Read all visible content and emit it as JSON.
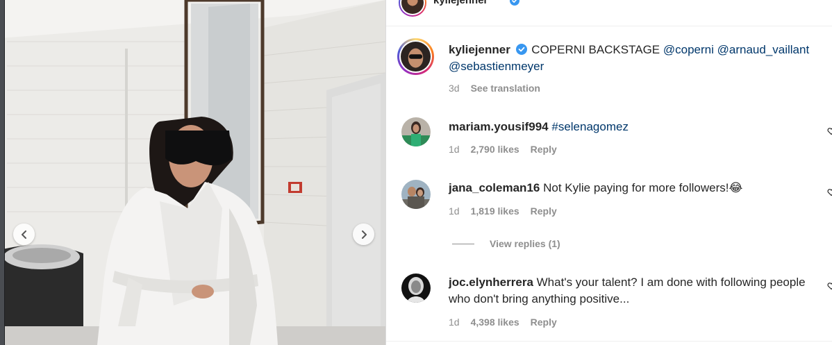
{
  "header": {
    "username": "kyliejenner"
  },
  "post": {
    "author": "kyliejenner",
    "caption_text": "COPERNI BACKSTAGE",
    "mentions": [
      "@coperni",
      "@arnaud_vaillant",
      "@sebastienmeyer"
    ],
    "time": "3d",
    "see_translation": "See translation"
  },
  "comments": [
    {
      "username": "mariam.yousif994",
      "text": "",
      "hashtag": "#selenagomez",
      "time": "1d",
      "likes": "2,790 likes",
      "reply": "Reply"
    },
    {
      "username": "jana_coleman16",
      "text": "Not Kylie paying for more followers!",
      "emoji": "😂",
      "time": "1d",
      "likes": "1,819 likes",
      "reply": "Reply",
      "view_replies": "View replies (1)"
    },
    {
      "username": "joc.elynherrera",
      "text": "What's your talent? I am done with following people who don't bring anything positive...",
      "time": "1d",
      "likes": "4,398 likes",
      "reply": "Reply"
    }
  ],
  "icons": {
    "verified": "verified-badge-icon",
    "prev": "chevron-left-icon",
    "next": "chevron-right-icon",
    "like": "heart-icon"
  },
  "colors": {
    "verified": "#3897f0",
    "link": "#00376b",
    "muted": "#8e8e8e"
  }
}
